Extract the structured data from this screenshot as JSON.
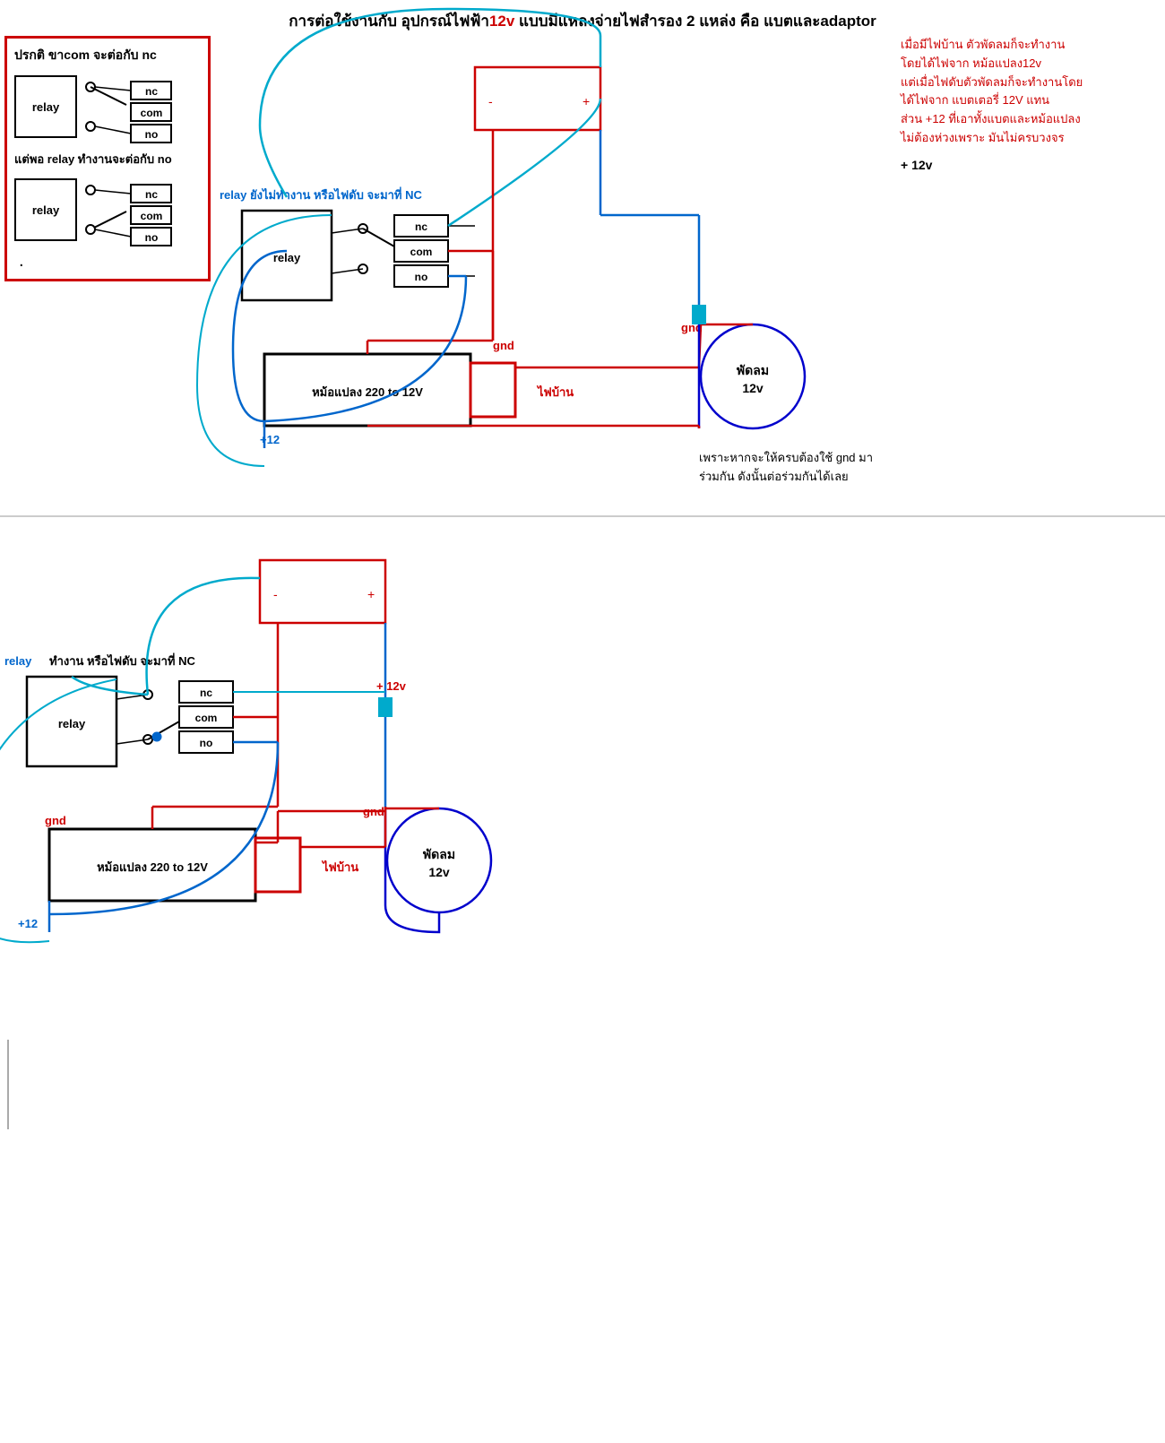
{
  "title": {
    "part1": "การต่อใช้งานกับ  อุปกรณ์ไฟฟ้า",
    "part2": "12v",
    "part3": " แบบมีแหลงจ่ายไฟสำรอง  2 แหล่ง  คือ  แบตและadaptor"
  },
  "left_box": {
    "title": "ปรกติ  ขาcom จะต่อกับ  nc",
    "relay1_label": "relay",
    "relay2_label": "relay",
    "mid_label": "แต่พอ  relay ทำงานจะต่อกับ  no",
    "contacts": [
      "nc",
      "com",
      "no"
    ]
  },
  "diagram1": {
    "relay_label": "relay",
    "status_text": "relay ยังไม่ทำงาน  หรือไฟดับ  จะมาที่  NC",
    "transformer_label": "หม้อแปลง  220 to 12V",
    "fan_label": "พัดลม\n12v",
    "home_label": "ไฟบ้าน",
    "gnd_label": "gnd",
    "plus12_label": "+ 12v",
    "plus12_label2": "+12",
    "gnd_label2": "gnd"
  },
  "diagram2": {
    "relay_label": "relay",
    "status_text": "relay  ทำงาน  หรือไฟดับ  จะมาที่  NC",
    "transformer_label": "หม้อแปลง  220 to 12V",
    "fan_label": "พัดลม\n12v",
    "home_label": "ไฟบ้าน",
    "gnd_label": "gnd",
    "plus12_label": "+ 12v",
    "plus12_label2": "+12",
    "gnd_label2": "gnd"
  },
  "right_text": {
    "line1": "เมื่อมีไฟบ้าน  ตัวพัดลมก็จะทำงาน",
    "line2": "โดยได้ไฟจาก  หม้อแปลง12v",
    "line3": "แต่เมื่อไฟดับตัวพัดลมก็จะทำงานโดย",
    "line4": "ได้ไฟจาก  แบตเตอรี่  12V แทน",
    "line5": "ส่วน  +12 ที่เอาทั้งแบตและหม้อแปลง",
    "line6": "ไม่ต้องห่วงเพราะ  มันไม่ครบวงจร"
  },
  "bottom_note": {
    "line1": "เพราะหากจะให้ครบต้องใช้  gnd มา",
    "line2": "ร่วมกัน  ดังนั้นต่อร่วมกันได้เลย"
  },
  "colors": {
    "red": "#cc0000",
    "blue": "#0066cc",
    "cyan": "#00aacc",
    "dark_blue": "#0000cc"
  }
}
